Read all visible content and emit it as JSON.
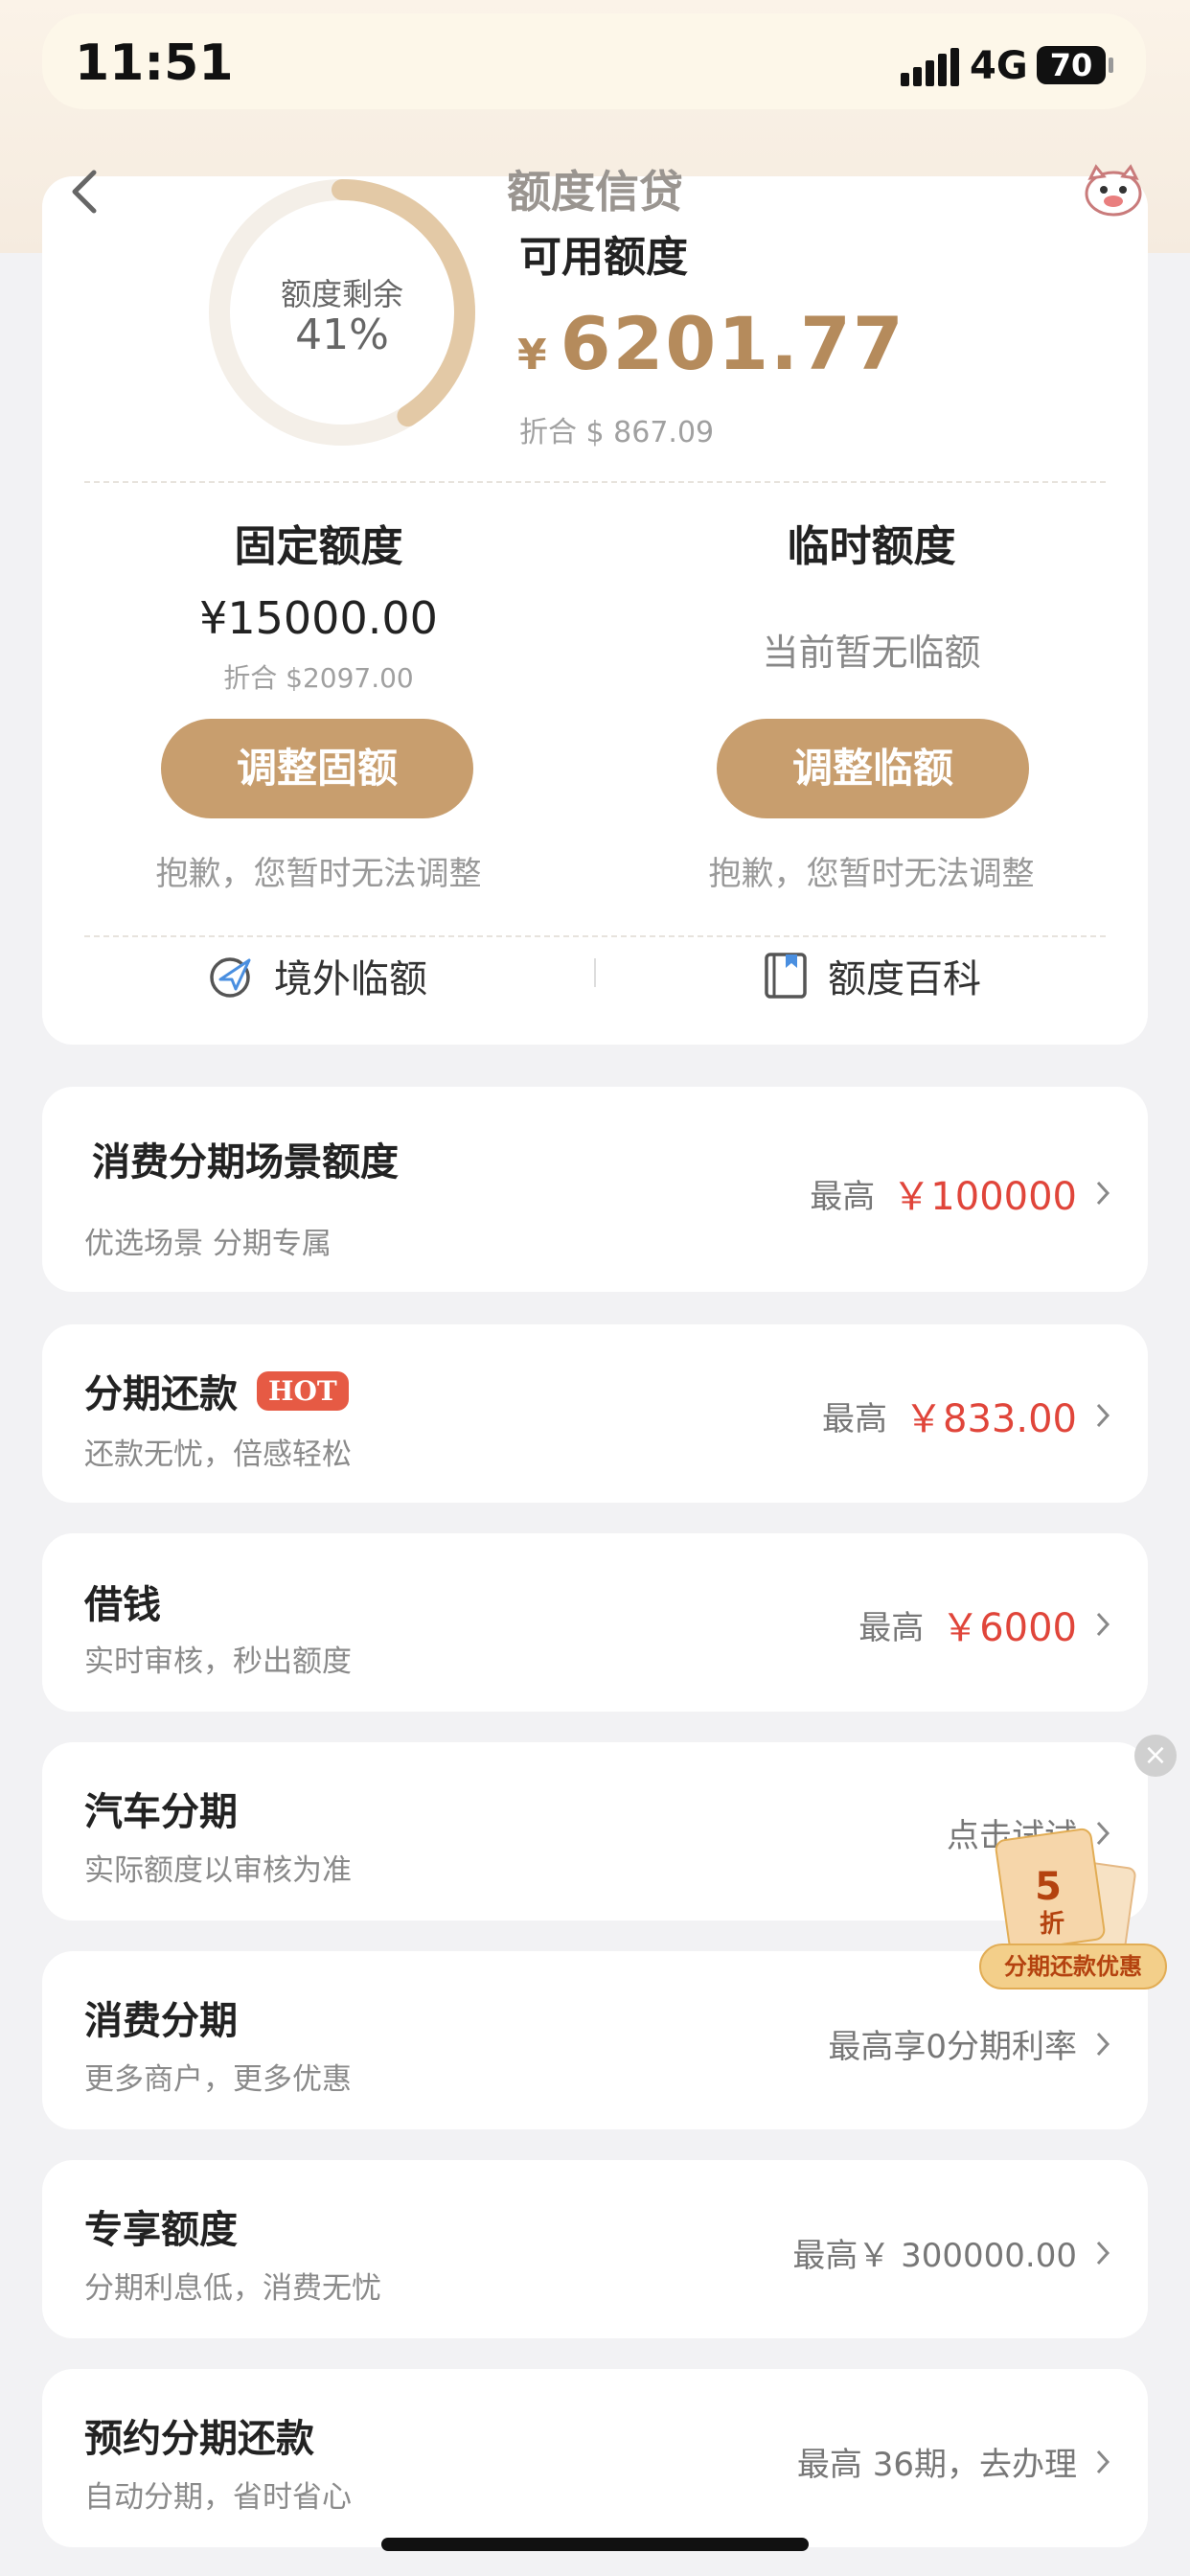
{
  "status_bar": {
    "time": "11:51",
    "network": "4G",
    "battery": "70"
  },
  "nav": {
    "title": "额度信贷"
  },
  "credit": {
    "ring_label": "额度剩余",
    "ring_percent": "41%",
    "ring_fraction": 0.41,
    "available_title": "可用额度",
    "available_currency": "¥",
    "available_amount": "6201.77",
    "available_converted": "折合 $ 867.09"
  },
  "fixed": {
    "title": "固定额度",
    "amount": "¥15000.00",
    "converted": "折合 $2097.00",
    "button": "调整固额",
    "note": "抱歉，您暂时无法调整"
  },
  "temporary": {
    "title": "临时额度",
    "empty_text": "当前暂无临额",
    "button": "调整临额",
    "note": "抱歉，您暂时无法调整"
  },
  "links": {
    "overseas": "境外临额",
    "wiki": "额度百科"
  },
  "items": [
    {
      "title": "消费分期场景额度",
      "sub": "优选场景 分期专属",
      "prefix": "最高",
      "value": "￥100000"
    },
    {
      "title": "分期还款",
      "badge": "HOT",
      "sub": "还款无忧，倍感轻松",
      "prefix": "最高",
      "value": "￥833.00"
    },
    {
      "title": "借钱",
      "sub": "实时审核，秒出额度",
      "prefix": "最高",
      "value": "￥6000"
    },
    {
      "title": "汽车分期",
      "sub": "实际额度以审核为准",
      "right_text": "点击试试"
    },
    {
      "title": "消费分期",
      "sub": "更多商户，更多优惠",
      "right_text": "最高享0分期利率"
    },
    {
      "title": "专享额度",
      "sub": "分期利息低，消费无忧",
      "right_text": "最高￥ 300000.00"
    },
    {
      "title": "预约分期还款",
      "sub": "自动分期，省时省心",
      "right_text": "最高 36期，去办理"
    }
  ],
  "promo": {
    "discount_num": "5",
    "discount_unit": "折",
    "label": "分期还款优惠"
  },
  "colors": {
    "accent": "#c89e6e",
    "amount": "#b58b5c",
    "highlight": "#e0453a"
  }
}
